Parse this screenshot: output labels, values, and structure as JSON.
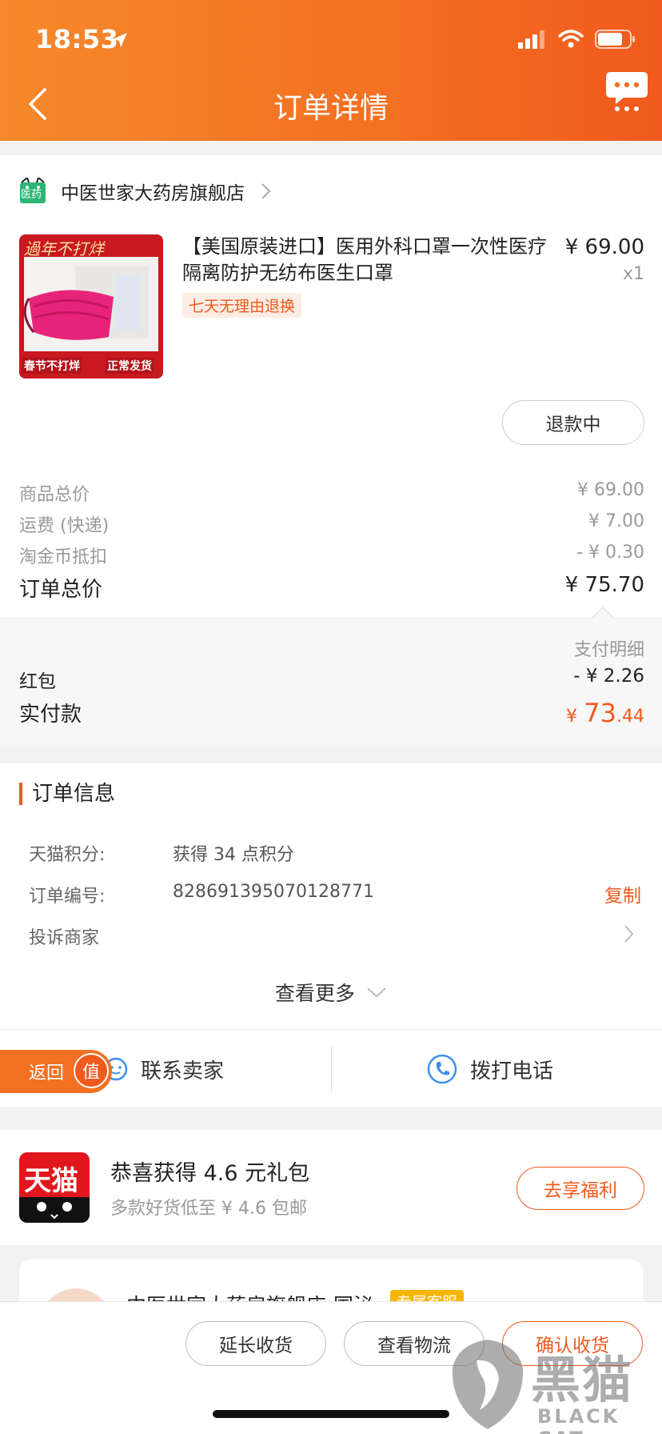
{
  "status_bar": {
    "time": "18:53"
  },
  "nav": {
    "title": "订单详情"
  },
  "shop": {
    "badge": "医药",
    "name": "中医世家大药房旗舰店"
  },
  "product": {
    "image_caption_top": "過年不打烊",
    "image_caption_left": "春节不打烊",
    "image_caption_right": "正常发货",
    "title": "【美国原装进口】医用外科口罩一次性医疗隔离防护无纺布医生口罩",
    "price": "¥ 69.00",
    "qty": "x1",
    "tag": "七天无理由退换",
    "refund_status": "退款中"
  },
  "prices": {
    "items_label": "商品总价",
    "items_value": "¥ 69.00",
    "shipping_label": "运费 (快递)",
    "shipping_value": "¥ 7.00",
    "coin_label": "淘金币抵扣",
    "coin_value": "- ¥ 0.30",
    "total_label": "订单总价",
    "total_value": "¥ 75.70",
    "detail_link": "支付明细",
    "redpacket_label": "红包",
    "redpacket_value": "- ¥ 2.26",
    "paid_label": "实付款",
    "paid_currency": "¥",
    "paid_int": "73",
    "paid_dec": ".44"
  },
  "order_info": {
    "title": "订单信息",
    "points_label": "天猫积分:",
    "points_value": "获得 34 点积分",
    "order_no_label": "订单编号:",
    "order_no_value": "828691395070128771",
    "copy": "复制",
    "complain": "投诉商家",
    "see_more": "查看更多"
  },
  "contact": {
    "seller": "联系卖家",
    "phone": "拨打电话",
    "return": "返回",
    "zhi": "值"
  },
  "promo": {
    "logo": "天猫",
    "title": "恭喜获得 4.6 元礼包",
    "subtitle": "多款好货低至 ¥ 4.6 包邮",
    "button": "去享福利"
  },
  "peek": {
    "text": "中医世家大药房旗舰店-国泌",
    "badge": "专属客服"
  },
  "bottom_actions": {
    "extend": "延长收货",
    "logistics": "查看物流",
    "confirm": "确认收货"
  },
  "watermark": {
    "cn": "黑猫",
    "en": "BLACK CAT"
  },
  "colors": {
    "accent": "#f05a1e",
    "header_start": "#f6892b",
    "header_end": "#f05a1e",
    "tmall_red": "#e0161c"
  }
}
